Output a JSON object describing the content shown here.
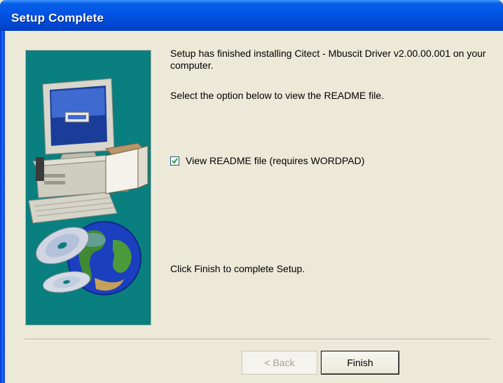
{
  "window": {
    "title": "Setup Complete"
  },
  "content": {
    "line1": "Setup has finished installing Citect - Mbuscit Driver v2.00.00.001 on your computer.",
    "line2": "Select the option below to view the README file.",
    "checkbox": {
      "label": "View README file  (requires WORDPAD)",
      "checked": true
    },
    "line3": "Click Finish to complete Setup."
  },
  "buttons": {
    "back_label": "< Back",
    "finish_label": "Finish"
  },
  "colors": {
    "titlebar": "#0055e5",
    "panel_bg": "#0a7f7f",
    "dialog_bg": "#ece9d8"
  },
  "icons": [
    "computer-icon",
    "cd-icon",
    "globe-icon",
    "check-icon"
  ]
}
